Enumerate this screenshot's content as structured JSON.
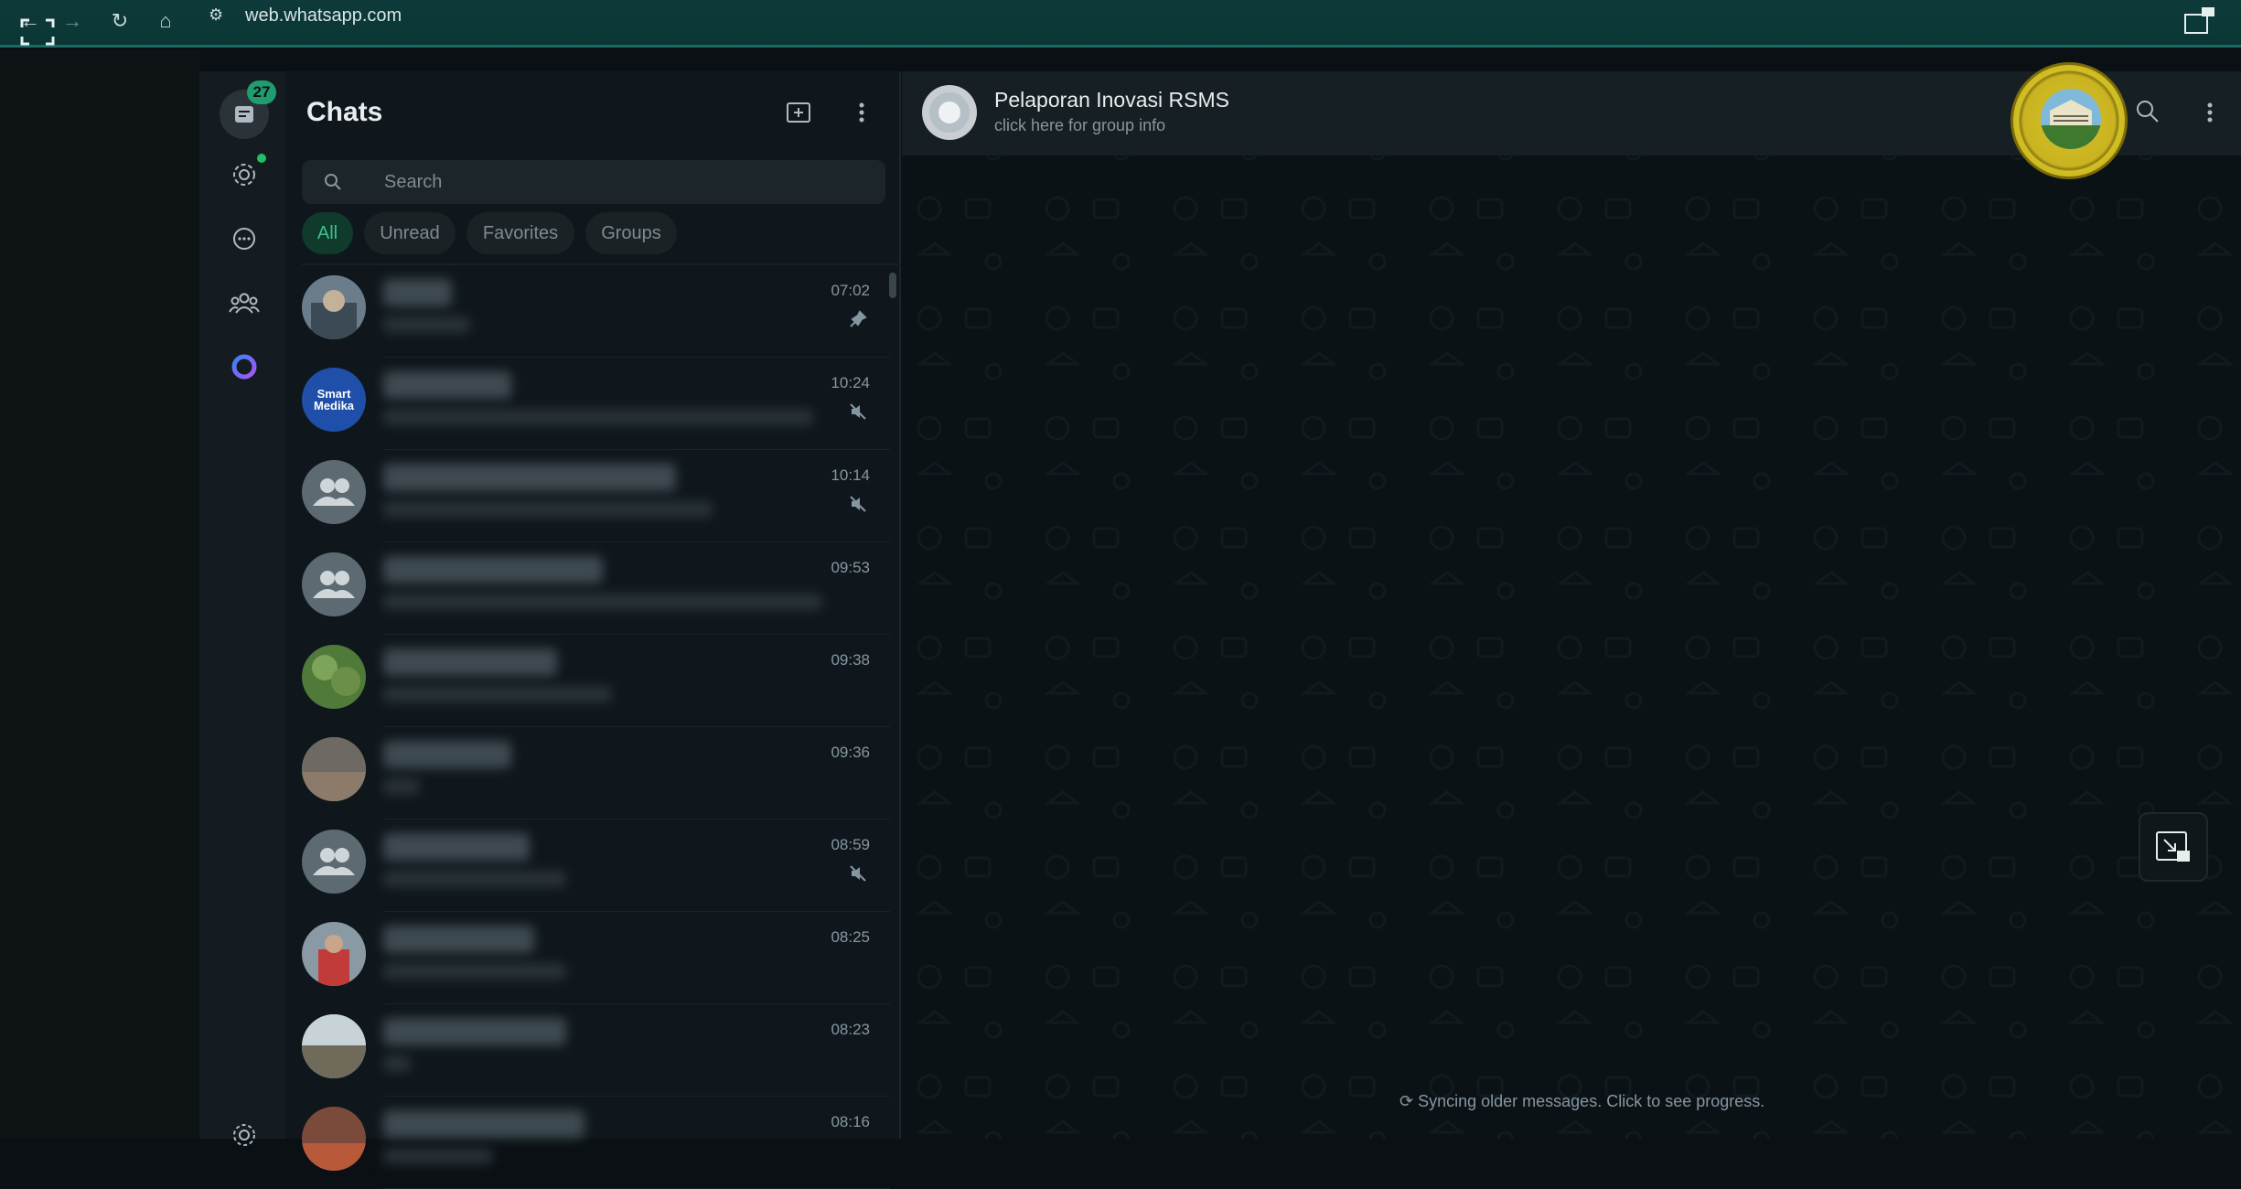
{
  "browser": {
    "url": "web.whatsapp.com"
  },
  "rail": {
    "chats_badge": "27"
  },
  "panel": {
    "title": "Chats",
    "search_placeholder": "Search",
    "filters": [
      "All",
      "Unread",
      "Favorites",
      "Groups"
    ]
  },
  "chats": [
    {
      "time": "07:02",
      "status_icon": "pin-icon",
      "avatar": "photo-person"
    },
    {
      "time": "10:24",
      "status_icon": "muted-icon",
      "avatar": "smart-medika-logo",
      "avatar_text": "Smart Medika"
    },
    {
      "time": "10:14",
      "status_icon": "muted-icon",
      "avatar": "group-placeholder"
    },
    {
      "time": "09:53",
      "status_icon": "",
      "avatar": "group-placeholder"
    },
    {
      "time": "09:38",
      "status_icon": "",
      "avatar": "photo-plants"
    },
    {
      "time": "09:36",
      "status_icon": "",
      "avatar": "photo-group"
    },
    {
      "time": "08:59",
      "status_icon": "muted-icon",
      "avatar": "group-placeholder"
    },
    {
      "time": "08:25",
      "status_icon": "",
      "avatar": "photo-red"
    },
    {
      "time": "08:23",
      "status_icon": "",
      "avatar": "photo-outdoor"
    },
    {
      "time": "08:16",
      "status_icon": "",
      "avatar": "photo-event"
    }
  ],
  "conversation": {
    "name": "Pelaporan Inovasi RSMS",
    "subtitle": "click here for group info",
    "sync_text": "Syncing older messages. Click to see progress."
  },
  "colors": {
    "accent": "#21c063",
    "panel_bg": "#0f171c",
    "header_bg": "#161f24"
  }
}
